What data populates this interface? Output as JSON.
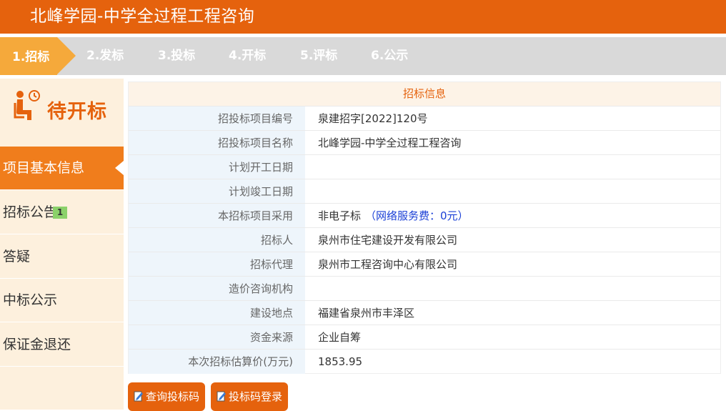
{
  "header": {
    "title": "北峰学园-中学全过程工程咨询"
  },
  "steps": [
    "1.招标",
    "2.发标",
    "3.投标",
    "4.开标",
    "5.评标",
    "6.公示"
  ],
  "status": {
    "icon": "waiting-person-icon",
    "label": "待开标"
  },
  "sidebar": {
    "items": [
      {
        "label": "项目基本信息",
        "active": true
      },
      {
        "label": "招标公告",
        "badge": "1"
      },
      {
        "label": "答疑"
      },
      {
        "label": "中标公示"
      },
      {
        "label": "保证金退还"
      }
    ]
  },
  "panel": {
    "title": "招标信息",
    "rows": [
      {
        "key": "招投标项目编号",
        "value": "泉建招字[2022]120号"
      },
      {
        "key": "招投标项目名称",
        "value": "北峰学园-中学全过程工程咨询"
      },
      {
        "key": "计划开工日期",
        "value": ""
      },
      {
        "key": "计划竣工日期",
        "value": ""
      },
      {
        "key": "本招标项目采用",
        "value": "非电子标",
        "note": "（网络服务费：0元）"
      },
      {
        "key": "招标人",
        "value": "泉州市住宅建设开发有限公司"
      },
      {
        "key": "招标代理",
        "value": "泉州市工程咨询中心有限公司"
      },
      {
        "key": "造价咨询机构",
        "value": ""
      },
      {
        "key": "建设地点",
        "value": "福建省泉州市丰泽区"
      },
      {
        "key": "资金来源",
        "value": "企业自筹"
      },
      {
        "key": "本次招标估算价(万元)",
        "value": "1853.95"
      }
    ]
  },
  "actions": {
    "query_code": "查询投标码",
    "code_login": "投标码登录",
    "icon": "edit-icon"
  },
  "colors": {
    "brand": "#e5620d",
    "step_active": "#f5a93b",
    "nav_active": "#f07d1c",
    "badge": "#8bd16a"
  }
}
